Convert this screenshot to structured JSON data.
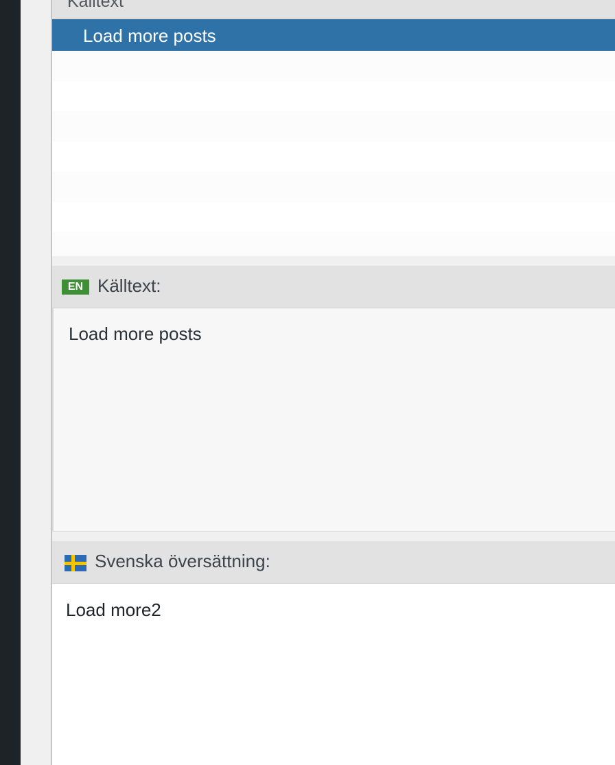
{
  "string_list": {
    "header_label": "Källtext",
    "rows": [
      {
        "text": "Load more posts",
        "selected": true
      },
      {
        "text": ""
      },
      {
        "text": ""
      },
      {
        "text": ""
      },
      {
        "text": ""
      },
      {
        "text": ""
      },
      {
        "text": ""
      },
      {
        "text": ""
      }
    ]
  },
  "source": {
    "lang_code": "EN",
    "label": "Källtext:",
    "text": "Load more posts"
  },
  "translation": {
    "label": "Svenska översättning:",
    "flag_icon": "sweden-flag-icon",
    "value": "Load more2"
  },
  "colors": {
    "selected_row": "#2f72a8",
    "lang_badge": "#3f8f36",
    "admin_sidebar": "#1d2327"
  }
}
